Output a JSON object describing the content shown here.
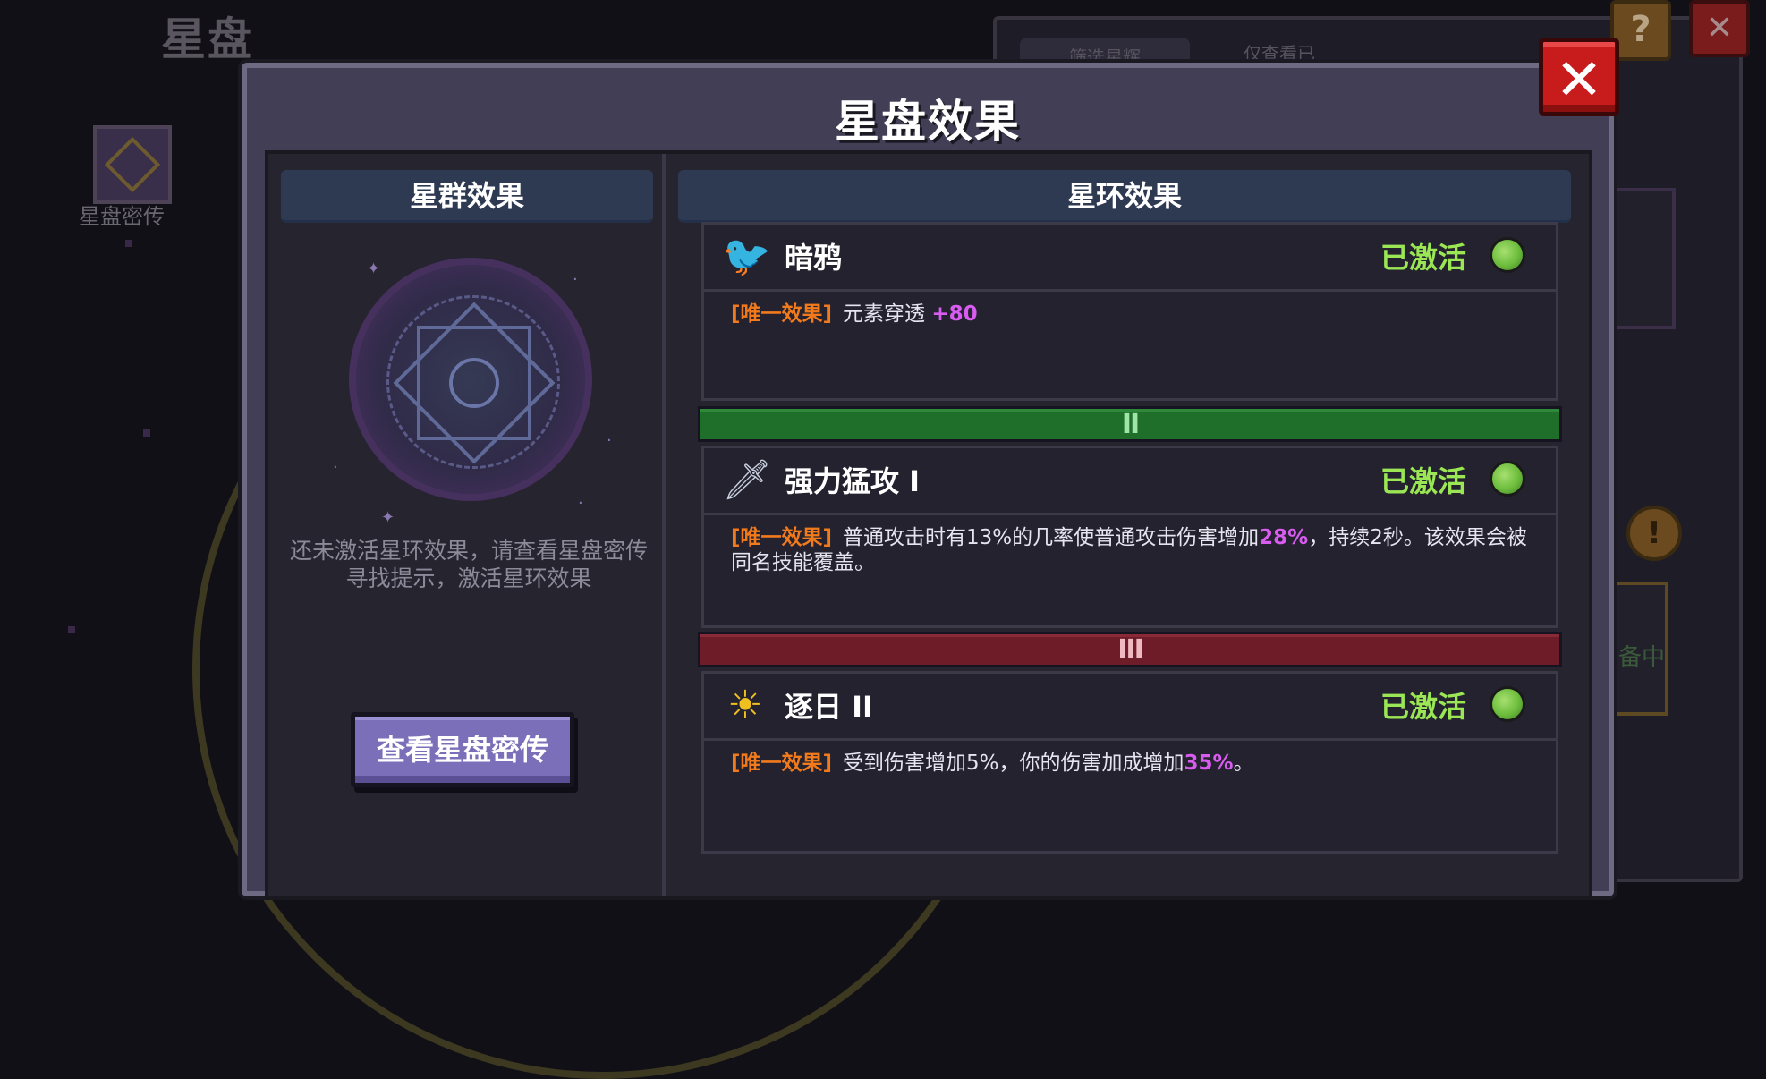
{
  "background": {
    "title": "星盘",
    "icon_label": "星盘密传",
    "tab_filter": "筛选星辉",
    "tab_only_view": "仅查看已",
    "help_glyph": "?",
    "close_glyph": "✕",
    "warn_glyph": "!",
    "side_label": "备中"
  },
  "dialog": {
    "title": "星盘效果",
    "close_glyph": "✕"
  },
  "left_panel": {
    "header": "星群效果",
    "message": "还未激活星环效果，请查看星盘密传寻找提示，激活星环效果",
    "button": "查看星盘密传"
  },
  "right_panel": {
    "header": "星环效果",
    "effects": [
      {
        "name": "暗鸦",
        "icon": "raven-icon",
        "status": "已激活",
        "tag": "[唯一效果]",
        "desc_parts": [
          "元素穿透 ",
          "+80",
          ""
        ]
      },
      {
        "tier": "II",
        "name": "强力猛攻 I",
        "icon": "sword-icon",
        "status": "已激活",
        "tag": "[唯一效果]",
        "desc_parts": [
          "普通攻击时有13%的几率使普通攻击伤害增加",
          "28%",
          "，持续2秒。该效果会被同名技能覆盖。"
        ]
      },
      {
        "tier": "III",
        "name": "逐日 II",
        "icon": "sun-icon",
        "status": "已激活",
        "tag": "[唯一效果]",
        "desc_parts": [
          "受到伤害增加5%，你的伤害加成增加",
          "35%",
          "。"
        ]
      }
    ]
  },
  "colors": {
    "active_green": "#9ae654",
    "tag_orange": "#f07a1c",
    "highlight_purple": "#d85cf0",
    "tier2_green": "#1f6e2a",
    "tier3_red": "#6e1c28"
  }
}
